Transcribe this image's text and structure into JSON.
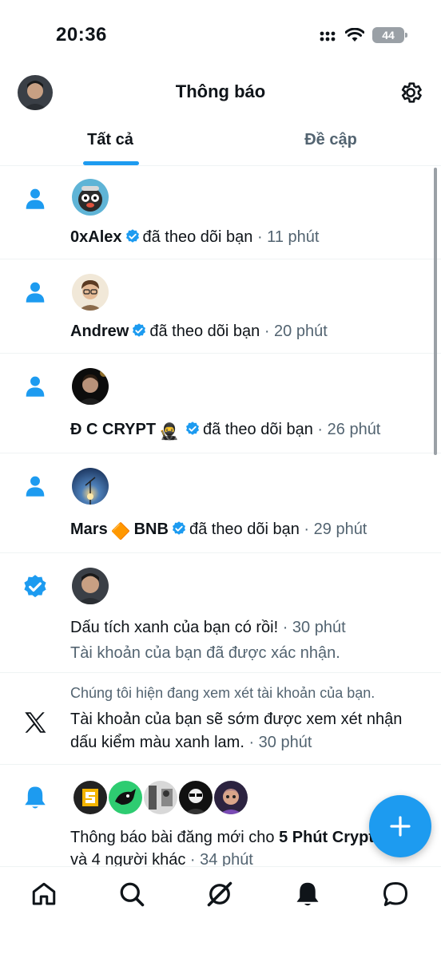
{
  "status_bar": {
    "time": "20:36",
    "battery": "44"
  },
  "header": {
    "title": "Thông báo"
  },
  "tabs": [
    {
      "label": "Tất cả",
      "active": true
    },
    {
      "label": "Đề cập",
      "active": false
    }
  ],
  "notifications": [
    {
      "type": "follow",
      "name": "0xAlex",
      "verified": true,
      "text": "đã theo dõi bạn",
      "time": "· 11 phút"
    },
    {
      "type": "follow",
      "name": "Andrew",
      "verified": true,
      "text": "đã theo dõi bạn",
      "time": "· 20 phút"
    },
    {
      "type": "follow",
      "name": "Ɖ Ϲ ϹRYPT",
      "emoji": "🥷",
      "verified": true,
      "text": "đã theo dõi bạn",
      "time": "· 26 phút"
    },
    {
      "type": "follow",
      "name": "Mars",
      "emoji": "🔶",
      "name_suffix": "BNB",
      "verified": true,
      "text": "đã theo dõi bạn",
      "time": "· 29 phút"
    },
    {
      "type": "verified",
      "text": "Dấu tích xanh của bạn có rồi!",
      "time": "· 30 phút",
      "subtext": "Tài khoản của bạn đã được xác nhận."
    },
    {
      "type": "x",
      "pretext": "Chúng tôi hiện đang xem xét tài khoản của bạn.",
      "text_line1": "Tài khoản của bạn sẽ sớm được xem xét nhận",
      "text_line2": "dấu kiểm màu xanh lam.",
      "time": "· 30 phút"
    },
    {
      "type": "posts",
      "text_prefix": "Thông báo bài đăng mới cho ",
      "bold": "5 Phút Crypto",
      "text_line2": "và 4 người khác",
      "time": "· 34 phút"
    }
  ],
  "colors": {
    "accent": "#1d9bf0",
    "text": "#0f1419",
    "muted": "#536471",
    "divider": "#eff3f4"
  },
  "bottom_nav": [
    "home-icon",
    "search-icon",
    "grok-icon",
    "bell-icon",
    "chat-icon"
  ]
}
